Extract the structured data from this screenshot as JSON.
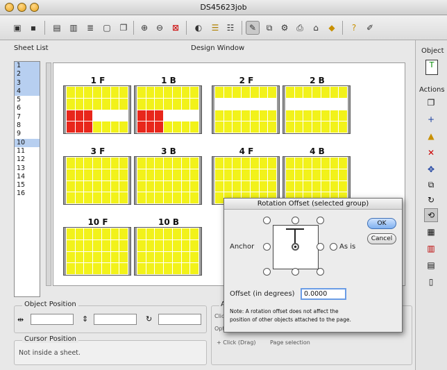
{
  "window": {
    "title": "DS45623job"
  },
  "toolbar": {
    "icons": [
      "save-icon",
      "disk-icon",
      "page-icon",
      "pages-icon",
      "sheets-icon",
      "paper-icon",
      "copy-icon",
      "zoom-in-icon",
      "zoom-out-icon",
      "zoom-fit-icon",
      "pie-icon",
      "layers-icon",
      "database-icon",
      "edit-icon",
      "duplicate-icon",
      "gear-icon",
      "print-icon",
      "cart-icon",
      "tag-icon",
      "help-icon",
      "pin-icon"
    ]
  },
  "sheet_list": {
    "label": "Sheet List",
    "items": [
      "1",
      "2",
      "3",
      "4",
      "5",
      "6",
      "7",
      "8",
      "9",
      "10",
      "11",
      "12",
      "13",
      "14",
      "15",
      "16"
    ]
  },
  "design": {
    "label": "Design Window",
    "sheets": [
      {
        "name": "1 F",
        "pattern": "redlow"
      },
      {
        "name": "1 B",
        "pattern": "redlow"
      },
      {
        "name": "2 F",
        "pattern": "whitemid"
      },
      {
        "name": "2 B",
        "pattern": "whitemid"
      },
      {
        "name": "3 F",
        "pattern": "yellow"
      },
      {
        "name": "3 B",
        "pattern": "yellow"
      },
      {
        "name": "4 F",
        "pattern": "yellow"
      },
      {
        "name": "4 B",
        "pattern": "yellow"
      },
      {
        "name": "10 F",
        "pattern": "yellow"
      },
      {
        "name": "10 B",
        "pattern": "yellow"
      }
    ]
  },
  "right_panel": {
    "object_label": "Object",
    "actions_label": "Actions"
  },
  "object_position": {
    "label": "Object Position"
  },
  "cursor_position": {
    "label": "Cursor Position",
    "value": "Not inside a sheet."
  },
  "assist": {
    "label": "A",
    "click_text": "Clic",
    "opt_text": "Opt",
    "drag_text": "+ Click (Drag)",
    "page_selection": "Page selection"
  },
  "dialog": {
    "title": "Rotation Offset (selected group)",
    "anchor_label": "Anchor",
    "as_is_label": "As is",
    "ok_label": "OK",
    "cancel_label": "Cancel",
    "offset_label": "Offset (in degrees)",
    "offset_value": "0.0000",
    "note_line1": "Note: A rotation offset does not affect  the",
    "note_line2": "position of other objects attached to the page."
  },
  "colors": {
    "accent": "#b7cff0",
    "cell_yellow": "#f2f21a",
    "cell_red": "#e8261b"
  }
}
